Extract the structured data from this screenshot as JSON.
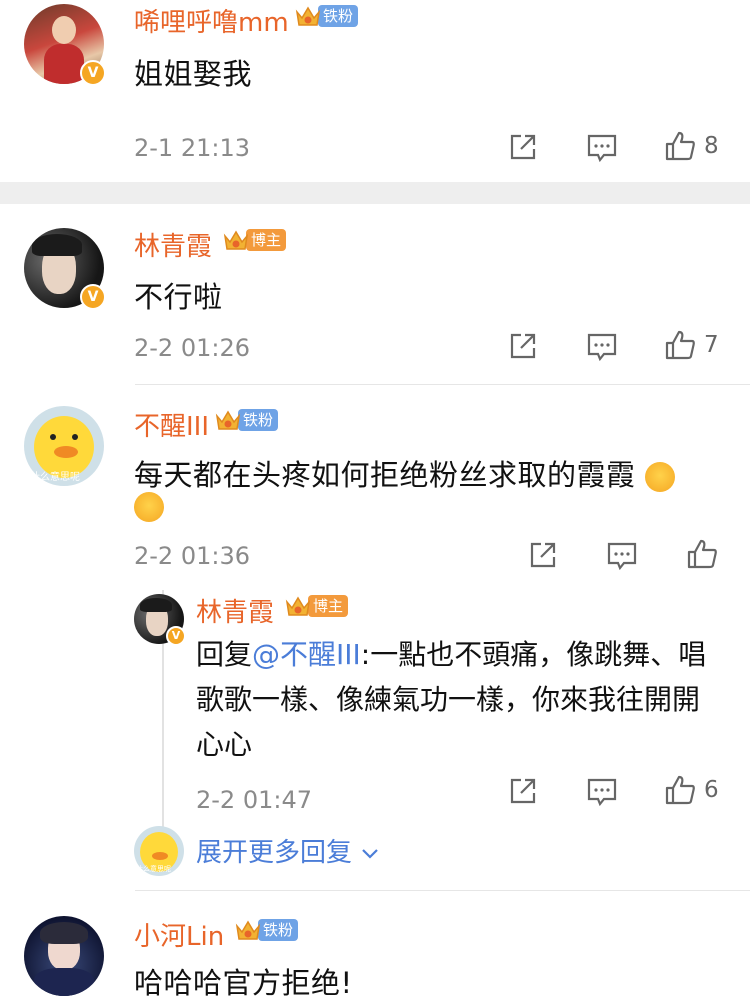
{
  "comments": [
    {
      "username": "唏哩呼噜mm",
      "badge": "铁粉",
      "text": "姐姐娶我",
      "time": "2-1 21:13",
      "likes": "8"
    },
    {
      "username": "林青霞",
      "badge": "博主",
      "text": "不行啦",
      "time": "2-2 01:26",
      "likes": "7"
    },
    {
      "username": "不醒III",
      "badge": "铁粉",
      "text": "每天都在头疼如何拒绝粉丝求取的霞霞",
      "time": "2-2 01:36",
      "likes": "",
      "avatar_caption": "什么意思呢"
    },
    {
      "username": "小河Lin",
      "badge": "铁粉",
      "text": "哈哈哈官方拒绝!"
    }
  ],
  "reply": {
    "username": "林青霞",
    "badge": "博主",
    "prefix": "回复",
    "mention": "@不醒III",
    "text": ":一點也不頭痛，像跳舞、唱歌歌一樣、像練氣功一樣，你來我往開開心心",
    "time": "2-2 01:47",
    "likes": "6"
  },
  "expand": {
    "label": "展开更多回复",
    "avatar_caption": "什么意思呢"
  },
  "colors": {
    "username": "#e8652a",
    "link": "#4b7dd8",
    "iron_badge": "#6fa3e6",
    "host_badge": "#f39a3c",
    "verified": "#f5a623"
  }
}
